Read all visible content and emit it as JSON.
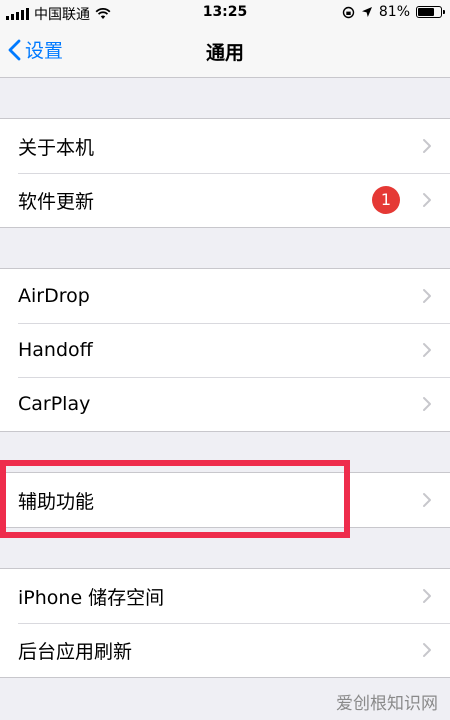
{
  "status_bar": {
    "carrier": "中国联通",
    "time": "13:25",
    "battery": "81%",
    "battery_level": 0.81
  },
  "nav": {
    "back_label": "设置",
    "title": "通用"
  },
  "groups": [
    {
      "rows": [
        {
          "label": "关于本机"
        },
        {
          "label": "软件更新",
          "badge": "1"
        }
      ]
    },
    {
      "rows": [
        {
          "label": "AirDrop"
        },
        {
          "label": "Handoff"
        },
        {
          "label": "CarPlay"
        }
      ]
    },
    {
      "rows": [
        {
          "label": "辅助功能"
        }
      ]
    },
    {
      "rows": [
        {
          "label": "iPhone 储存空间"
        },
        {
          "label": "后台应用刷新"
        }
      ]
    }
  ],
  "colors": {
    "accent": "#007aff",
    "badge": "#e53935",
    "highlight": "#ee2c4c"
  },
  "watermark": "爱创根知识网"
}
